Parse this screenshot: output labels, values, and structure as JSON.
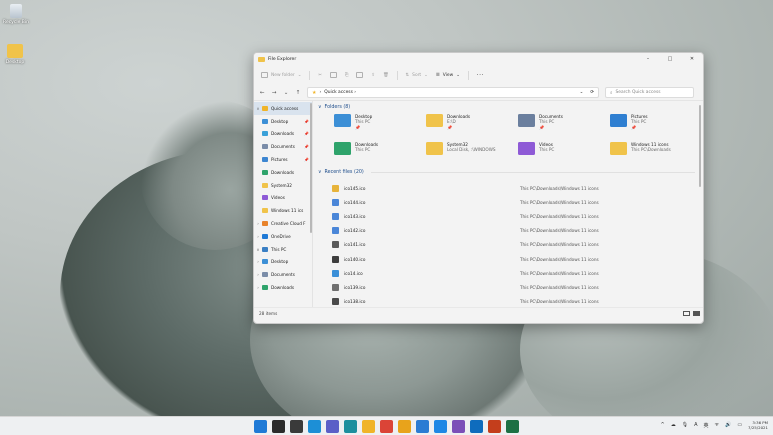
{
  "desktop": {
    "icons": [
      {
        "label": "Recycle Bin"
      },
      {
        "label": "Desktop"
      }
    ]
  },
  "window": {
    "title": "File Explorer",
    "controls": {
      "minimize": "–",
      "maximize": "□",
      "close": "✕"
    },
    "toolbar": {
      "new_folder": "New folder",
      "sort": "Sort",
      "view": "View",
      "more": "···"
    },
    "address": {
      "back": "←",
      "forward": "→",
      "up": "↑",
      "path": "Quick access",
      "refresh": "⟳",
      "search_placeholder": "Search Quick access"
    },
    "nav": {
      "items": [
        {
          "chev": "∨",
          "label": "Quick access",
          "color": "#f0b429",
          "pin": "",
          "selected": true
        },
        {
          "chev": "",
          "label": "Desktop",
          "color": "#3c8fd6",
          "pin": "📌"
        },
        {
          "chev": "",
          "label": "Downloads",
          "color": "#3aa0d8",
          "pin": "📌"
        },
        {
          "chev": "",
          "label": "Documents",
          "color": "#7a8ca8",
          "pin": "📌"
        },
        {
          "chev": "",
          "label": "Pictures",
          "color": "#3d86d1",
          "pin": "📌"
        },
        {
          "chev": "",
          "label": "Downloads",
          "color": "#2ea36b",
          "pin": ""
        },
        {
          "chev": "",
          "label": "System32",
          "color": "#f0c34a",
          "pin": ""
        },
        {
          "chev": "",
          "label": "Videos",
          "color": "#8e5ad6",
          "pin": ""
        },
        {
          "chev": "",
          "label": "Windows 11 ics",
          "color": "#f0c34a",
          "pin": ""
        },
        {
          "chev": "›",
          "label": "Creative Cloud F",
          "color": "#e8832b",
          "pin": ""
        },
        {
          "chev": "›",
          "label": "OneDrive",
          "color": "#1f7ad6",
          "pin": ""
        },
        {
          "chev": "∨",
          "label": "This PC",
          "color": "#3a7fc4",
          "pin": ""
        },
        {
          "chev": "›",
          "label": "Desktop",
          "color": "#3c8fd6",
          "pin": ""
        },
        {
          "chev": "›",
          "label": "Documents",
          "color": "#7a8ca8",
          "pin": ""
        },
        {
          "chev": "›",
          "label": "Downloads",
          "color": "#2ea36b",
          "pin": ""
        }
      ]
    },
    "folders_header": "Folders (8)",
    "folders": [
      {
        "name": "Desktop",
        "sub1": "This PC",
        "sub2": "📌",
        "color": "#3c8fd6"
      },
      {
        "name": "Downloads",
        "sub1": "E:\\D",
        "sub2": "📌",
        "color": "#f0c34a"
      },
      {
        "name": "Documents",
        "sub1": "This PC",
        "sub2": "📌",
        "color": "#6b7f9e"
      },
      {
        "name": "Pictures",
        "sub1": "This PC",
        "sub2": "📌",
        "color": "#2f7fd1"
      },
      {
        "name": "Downloads",
        "sub1": "This PC",
        "sub2": "",
        "color": "#2ea36b"
      },
      {
        "name": "System32",
        "sub1": "Local Disk, :\\WINDOWS",
        "sub2": "",
        "color": "#f0c34a"
      },
      {
        "name": "Videos",
        "sub1": "This PC",
        "sub2": "",
        "color": "#8e5ad6"
      },
      {
        "name": "Windows 11 icons",
        "sub1": "This PC\\Downloads",
        "sub2": "",
        "color": "#f0c34a"
      }
    ],
    "recent_header": "Recent files (20)",
    "recent": [
      {
        "name": "ico145.ico",
        "loc": "This PC\\Downloads\\Windows 11 icons",
        "color": "#e7b33a"
      },
      {
        "name": "ico144.ico",
        "loc": "This PC\\Downloads\\Windows 11 icons",
        "color": "#4a86d8"
      },
      {
        "name": "ico143.ico",
        "loc": "This PC\\Downloads\\Windows 11 icons",
        "color": "#4a86d8"
      },
      {
        "name": "ico142.ico",
        "loc": "This PC\\Downloads\\Windows 11 icons",
        "color": "#4a86d8"
      },
      {
        "name": "ico141.ico",
        "loc": "This PC\\Downloads\\Windows 11 icons",
        "color": "#5a5a5a"
      },
      {
        "name": "ico140.ico",
        "loc": "This PC\\Downloads\\Windows 11 icons",
        "color": "#3d3d3d"
      },
      {
        "name": "ico14.ico",
        "loc": "This PC\\Downloads\\Windows 11 icons",
        "color": "#3a8fd8"
      },
      {
        "name": "ico139.ico",
        "loc": "This PC\\Downloads\\Windows 11 icons",
        "color": "#6f6f6f"
      },
      {
        "name": "ico138.ico",
        "loc": "This PC\\Downloads\\Windows 11 icons",
        "color": "#4a4a4a"
      }
    ],
    "status": {
      "count": "28 items"
    }
  },
  "taskbar": {
    "apps": [
      {
        "name": "start",
        "color": "#1f7ad6"
      },
      {
        "name": "search",
        "color": "#2b2b2b"
      },
      {
        "name": "task-view",
        "color": "#3a3a3a"
      },
      {
        "name": "widgets",
        "color": "#1d8fd6"
      },
      {
        "name": "chat",
        "color": "#5b5fc7"
      },
      {
        "name": "edge",
        "color": "#1c8f9e"
      },
      {
        "name": "file-explorer",
        "color": "#f0b429"
      },
      {
        "name": "chrome",
        "color": "#db4437"
      },
      {
        "name": "chrome-canary",
        "color": "#e8a31b"
      },
      {
        "name": "todo",
        "color": "#2b7cd3"
      },
      {
        "name": "vscode",
        "color": "#1e88e5"
      },
      {
        "name": "vs",
        "color": "#7b4fb8"
      },
      {
        "name": "outlook",
        "color": "#0f6cbd"
      },
      {
        "name": "powerpoint",
        "color": "#c43e1c"
      },
      {
        "name": "excel",
        "color": "#1d7044"
      }
    ],
    "tray": {
      "chevron": "^",
      "lang": "A",
      "ime": "英",
      "time": "3:36 PM",
      "date": "7/25/2021"
    }
  }
}
